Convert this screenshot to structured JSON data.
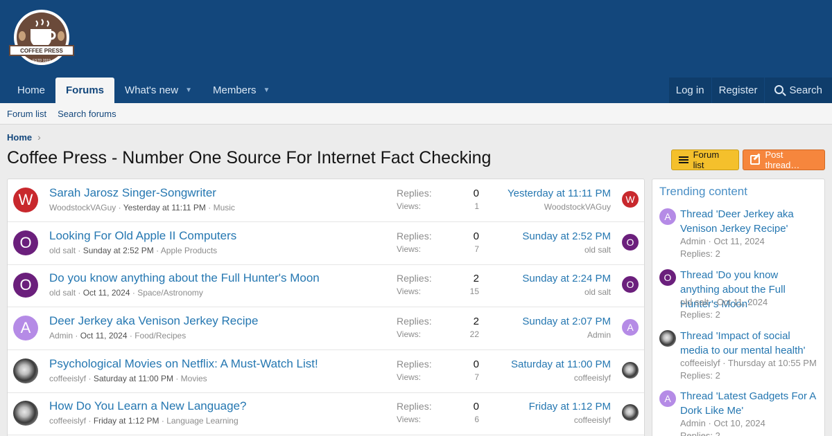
{
  "brand": {
    "logo_top_text": "COFFEE PRESS",
    "logo_sub_text": "ESTD 2019"
  },
  "nav": {
    "tabs": [
      {
        "label": "Home"
      },
      {
        "label": "Forums"
      },
      {
        "label": "What's new"
      },
      {
        "label": "Members"
      }
    ],
    "right": {
      "login": "Log in",
      "register": "Register",
      "search": "Search"
    }
  },
  "subnav": {
    "forum_list": "Forum list",
    "search_forums": "Search forums"
  },
  "breadcrumb": {
    "home": "Home",
    "chevron": "›"
  },
  "page": {
    "title": "Coffee Press - Number One Source For Internet Fact Checking",
    "forum_list_button": "Forum list",
    "post_thread_button": "Post thread…"
  },
  "labels": {
    "replies": "Replies:",
    "views": "Views:",
    "separator": " · "
  },
  "threads": [
    {
      "avatar_letter": "W",
      "avatar_color": "#c8282d",
      "title": "Sarah Jarosz Singer-Songwriter",
      "author": "WoodstockVAGuy",
      "date": "Yesterday at 11:11 PM",
      "forum": "Music",
      "replies": "0",
      "views": "1",
      "last_date": "Yesterday at 11:11 PM",
      "last_user": "WoodstockVAGuy"
    },
    {
      "avatar_letter": "O",
      "avatar_color": "#6b1f7c",
      "title": "Looking For Old Apple II Computers",
      "author": "old salt",
      "date": "Sunday at 2:52 PM",
      "forum": "Apple Products",
      "replies": "0",
      "views": "7",
      "last_date": "Sunday at 2:52 PM",
      "last_user": "old salt"
    },
    {
      "avatar_letter": "O",
      "avatar_color": "#6b1f7c",
      "title": "Do you know anything about the Full Hunter's Moon",
      "author": "old salt",
      "date": "Oct 11, 2024",
      "forum": "Space/Astronomy",
      "replies": "2",
      "views": "15",
      "last_date": "Sunday at 2:24 PM",
      "last_user": "old salt"
    },
    {
      "avatar_letter": "A",
      "avatar_color": "#b58be6",
      "title": "Deer Jerkey aka Venison Jerkey Recipe",
      "author": "Admin",
      "date": "Oct 11, 2024",
      "forum": "Food/Recipes",
      "replies": "2",
      "views": "22",
      "last_date": "Sunday at 2:07 PM",
      "last_user": "Admin"
    },
    {
      "avatar_letter": "",
      "avatar_color": "photo",
      "title": "Psychological Movies on Netflix: A Must-Watch List!",
      "author": "coffeeislyf",
      "date": "Saturday at 11:00 PM",
      "forum": "Movies",
      "replies": "0",
      "views": "7",
      "last_date": "Saturday at 11:00 PM",
      "last_user": "coffeeislyf"
    },
    {
      "avatar_letter": "",
      "avatar_color": "photo",
      "title": "How Do You Learn a New Language?",
      "author": "coffeeislyf",
      "date": "Friday at 1:12 PM",
      "forum": "Language Learning",
      "replies": "0",
      "views": "6",
      "last_date": "Friday at 1:12 PM",
      "last_user": "coffeeislyf"
    }
  ],
  "sidebar": {
    "title": "Trending content",
    "items": [
      {
        "avatar_letter": "A",
        "avatar_color": "#b58be6",
        "title": "Thread 'Deer Jerkey aka Venison Jerkey Recipe'",
        "author": "Admin",
        "date": "Oct 11, 2024",
        "replies": "Replies: 2"
      },
      {
        "avatar_letter": "O",
        "avatar_color": "#6b1f7c",
        "title": "Thread 'Do you know anything about the Full Hunter's Moon'",
        "author": "old salt",
        "date": "Oct 11, 2024",
        "replies": "Replies: 2"
      },
      {
        "avatar_letter": "",
        "avatar_color": "photo",
        "title": "Thread 'Impact of social media to our mental health'",
        "author": "coffeeislyf",
        "date": "Thursday at 10:55 PM",
        "replies": "Replies: 2"
      },
      {
        "avatar_letter": "A",
        "avatar_color": "#b58be6",
        "title": "Thread 'Latest Gadgets For A Dork Like Me'",
        "author": "Admin",
        "date": "Oct 10, 2024",
        "replies": "Replies: 2"
      }
    ]
  },
  "colors": {
    "header_bg": "#13477c",
    "link": "#2577b1",
    "forum_list_btn": "#f4c02c",
    "post_btn": "#f6863d"
  }
}
